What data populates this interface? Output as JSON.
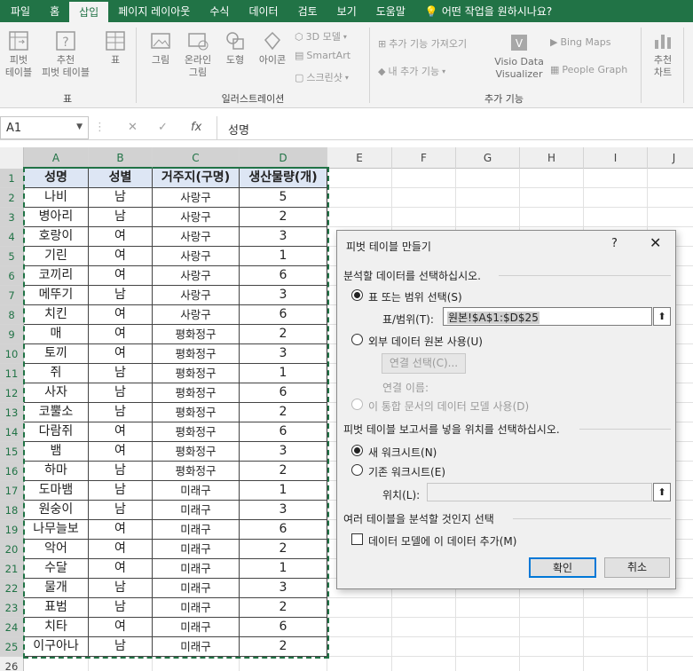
{
  "tabs": [
    "파일",
    "홈",
    "삽입",
    "페이지 레이아웃",
    "수식",
    "데이터",
    "검토",
    "보기",
    "도움말",
    "어떤 작업을 원하시나요?"
  ],
  "ribbon": {
    "pivot": "피벗\n테이블",
    "recpivot": "추천\n피벗 테이블",
    "table": "표",
    "picture": "그림",
    "online": "온라인\n그림",
    "shapes": "도형",
    "icons": "아이콘",
    "model3d": "3D 모델",
    "smartart": "SmartArt",
    "screenshot": "스크린샷",
    "getaddins": "추가 기능 가져오기",
    "myaddins": "내 추가 기능",
    "visio": "Visio Data\nVisualizer",
    "bing": "Bing Maps",
    "people": "People Graph",
    "recchart": "추천\n차트",
    "group_table": "표",
    "group_illus": "일러스트레이션",
    "group_addins": "추가 기능"
  },
  "formula": {
    "namebox": "A1",
    "fx": "fx",
    "content": "성명"
  },
  "columns": [
    "A",
    "B",
    "C",
    "D",
    "E",
    "F",
    "G",
    "H",
    "I",
    "J"
  ],
  "rows": [
    [
      "성명",
      "성별",
      "거주지(구명)",
      "생산물량(개)"
    ],
    [
      "나비",
      "남",
      "사랑구",
      "5"
    ],
    [
      "병아리",
      "남",
      "사랑구",
      "2"
    ],
    [
      "호랑이",
      "여",
      "사랑구",
      "3"
    ],
    [
      "기린",
      "여",
      "사랑구",
      "1"
    ],
    [
      "코끼리",
      "여",
      "사랑구",
      "6"
    ],
    [
      "메뚜기",
      "남",
      "사랑구",
      "3"
    ],
    [
      "치킨",
      "여",
      "사랑구",
      "6"
    ],
    [
      "매",
      "여",
      "평화정구",
      "2"
    ],
    [
      "토끼",
      "여",
      "평화정구",
      "3"
    ],
    [
      "쥐",
      "남",
      "평화정구",
      "1"
    ],
    [
      "사자",
      "남",
      "평화정구",
      "6"
    ],
    [
      "코뿔소",
      "남",
      "평화정구",
      "2"
    ],
    [
      "다람쥐",
      "여",
      "평화정구",
      "6"
    ],
    [
      "뱀",
      "여",
      "평화정구",
      "3"
    ],
    [
      "하마",
      "남",
      "평화정구",
      "2"
    ],
    [
      "도마뱀",
      "남",
      "미래구",
      "1"
    ],
    [
      "원숭이",
      "남",
      "미래구",
      "3"
    ],
    [
      "나무늘보",
      "여",
      "미래구",
      "6"
    ],
    [
      "악어",
      "여",
      "미래구",
      "2"
    ],
    [
      "수달",
      "여",
      "미래구",
      "1"
    ],
    [
      "물개",
      "남",
      "미래구",
      "3"
    ],
    [
      "표범",
      "남",
      "미래구",
      "2"
    ],
    [
      "치타",
      "여",
      "미래구",
      "6"
    ],
    [
      "이구아나",
      "남",
      "미래구",
      "2"
    ]
  ],
  "dialog": {
    "title": "피벗 테이블 만들기",
    "help": "?",
    "close": "✕",
    "section1": "분석할 데이터를 선택하십시오.",
    "opt_range": "표 또는 범위 선택(S)",
    "range_label": "표/범위(T):",
    "range_value": "원본!$A$1:$D$25",
    "opt_external": "외부 데이터 원본 사용(U)",
    "conn_btn": "연결 선택(C)...",
    "conn_name": "연결 이름:",
    "opt_model": "이 통합 문서의 데이터 모델 사용(D)",
    "section2": "피벗 테이블 보고서를 넣을 위치를 선택하십시오.",
    "opt_new": "새 워크시트(N)",
    "opt_existing": "기존 워크시트(E)",
    "loc_label": "위치(L):",
    "section3": "여러 테이블을 분석할 것인지 선택",
    "chk_model": "데이터 모델에 이 데이터 추가(M)",
    "ok": "확인",
    "cancel": "취소"
  }
}
